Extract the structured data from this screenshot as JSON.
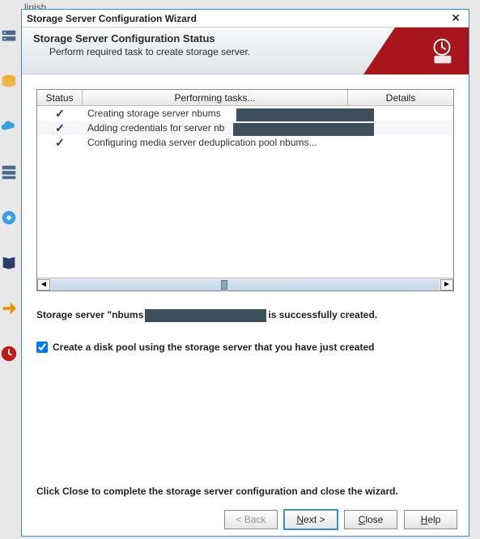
{
  "bg_text": "linish.",
  "dialog": {
    "title": "Storage Server Configuration Wizard",
    "banner_title": "Storage Server Configuration Status",
    "banner_sub": "Perform required task to create storage server."
  },
  "table": {
    "col_status": "Status",
    "col_task": "Performing tasks...",
    "col_details": "Details",
    "rows": [
      {
        "status": "done",
        "task": "Creating storage server nbums"
      },
      {
        "status": "done",
        "task": "Adding credentials for server nb"
      },
      {
        "status": "done",
        "task": "Configuring media server deduplication pool nbums..."
      }
    ]
  },
  "status_line_prefix": "Storage server \"nbums",
  "status_line_suffix": "is successfully created.",
  "checkbox_label": "Create a disk pool using the storage server that you have just created",
  "checkbox_checked": true,
  "footer_text": "Click Close to complete the storage server configuration and close the wizard.",
  "buttons": {
    "back": "< Back",
    "next": "Next >",
    "close": "Close",
    "help": "Help"
  },
  "sidebar_icons": [
    "server-icon",
    "disk-icon",
    "cloud-icon",
    "server2-icon",
    "cd-icon",
    "book-icon",
    "arrow-icon",
    "clock-icon"
  ]
}
